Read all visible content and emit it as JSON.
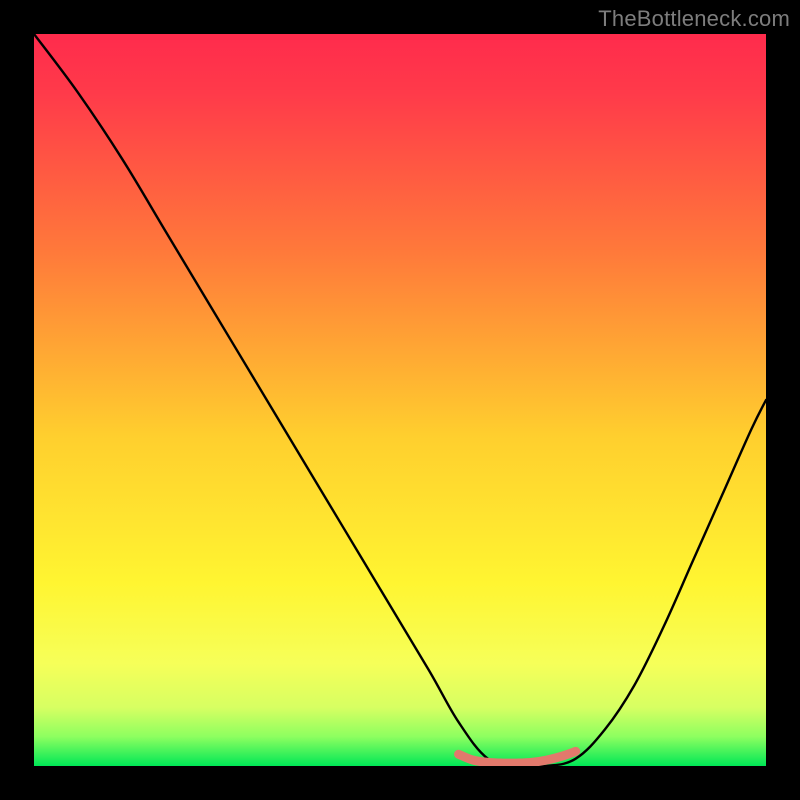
{
  "watermark": "TheBottleneck.com",
  "colors": {
    "frame": "#000000",
    "gradient_top": "#ff2b4c",
    "gradient_mid1": "#ff6a3c",
    "gradient_mid2": "#ffb02e",
    "gradient_mid3": "#ffe731",
    "gradient_mid4": "#f3ff58",
    "gradient_bottom": "#00e756",
    "curve": "#000000",
    "marker": "#e2796c"
  },
  "chart_data": {
    "type": "line",
    "title": "",
    "xlabel": "",
    "ylabel": "",
    "xlim": [
      0,
      100
    ],
    "ylim": [
      0,
      100
    ],
    "series": [
      {
        "name": "bottleneck-curve",
        "x": [
          0,
          6,
          12,
          18,
          24,
          30,
          36,
          42,
          48,
          54,
          58,
          62,
          66,
          70,
          74,
          78,
          82,
          86,
          90,
          94,
          98,
          100
        ],
        "values": [
          100,
          92,
          83,
          73,
          63,
          53,
          43,
          33,
          23,
          13,
          6,
          1,
          0,
          0,
          1,
          5,
          11,
          19,
          28,
          37,
          46,
          50
        ]
      },
      {
        "name": "optimal-marker",
        "x": [
          58,
          60,
          62,
          64,
          66,
          68,
          70,
          72,
          74
        ],
        "values": [
          1.6,
          0.8,
          0.5,
          0.4,
          0.4,
          0.5,
          0.8,
          1.3,
          2.0
        ]
      }
    ],
    "gradient_stops": [
      {
        "offset": 0.0,
        "color": "#ff2b4c"
      },
      {
        "offset": 0.08,
        "color": "#ff3a4a"
      },
      {
        "offset": 0.3,
        "color": "#ff7a3a"
      },
      {
        "offset": 0.55,
        "color": "#ffcf2e"
      },
      {
        "offset": 0.75,
        "color": "#fff531"
      },
      {
        "offset": 0.86,
        "color": "#f6ff59"
      },
      {
        "offset": 0.92,
        "color": "#d7ff62"
      },
      {
        "offset": 0.96,
        "color": "#8dff60"
      },
      {
        "offset": 1.0,
        "color": "#00e756"
      }
    ]
  }
}
